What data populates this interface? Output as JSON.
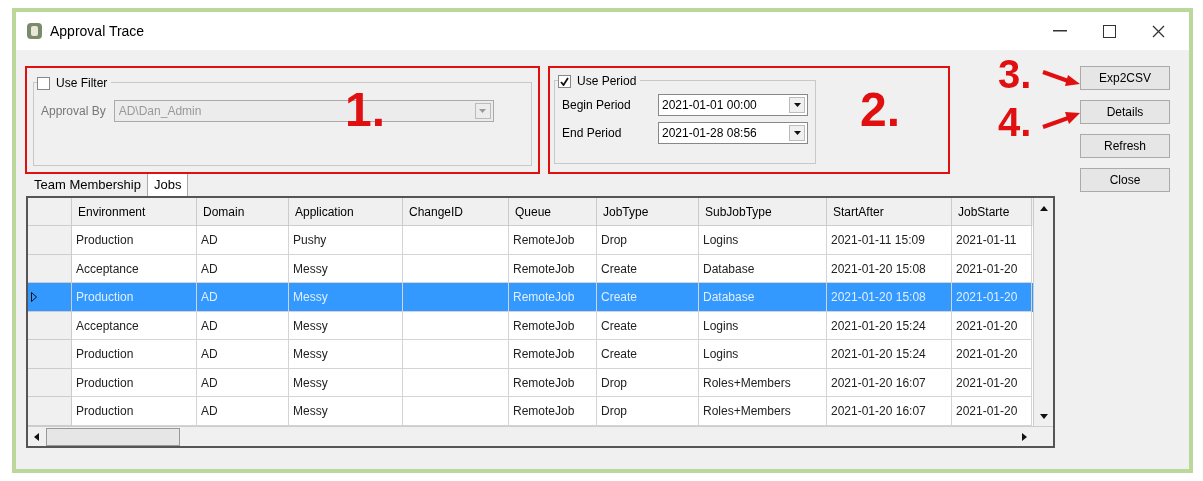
{
  "window": {
    "title": "Approval Trace"
  },
  "filter_group": {
    "label": "Use Filter",
    "checked": false,
    "field_label": "Approval By",
    "value": "AD\\Dan_Admin",
    "disabled": true
  },
  "period_group": {
    "label": "Use Period",
    "checked": true,
    "begin_label": "Begin Period",
    "begin_value": "2021-01-01 00:00",
    "end_label": "End Period",
    "end_value": "2021-01-28 08:56"
  },
  "buttons": [
    "Exp2CSV",
    "Details",
    "Refresh",
    "Close"
  ],
  "annotations": [
    "1.",
    "2.",
    "3.",
    "4."
  ],
  "tabs": [
    {
      "label": "Team Membership",
      "selected": false
    },
    {
      "label": "Jobs",
      "selected": true
    }
  ],
  "table": {
    "columns": [
      "Environment",
      "Domain",
      "Application",
      "ChangeID",
      "Queue",
      "JobType",
      "SubJobType",
      "StartAfter",
      "JobStarte"
    ],
    "rows": [
      {
        "selected": false,
        "cells": [
          "Production",
          "AD",
          "Pushy",
          "",
          "RemoteJob",
          "Drop",
          "Logins",
          "2021-01-11 15:09",
          "2021-01-11"
        ]
      },
      {
        "selected": false,
        "cells": [
          "Acceptance",
          "AD",
          "Messy",
          "",
          "RemoteJob",
          "Create",
          "Database",
          "2021-01-20 15:08",
          "2021-01-20"
        ]
      },
      {
        "selected": true,
        "cells": [
          "Production",
          "AD",
          "Messy",
          "",
          "RemoteJob",
          "Create",
          "Database",
          "2021-01-20 15:08",
          "2021-01-20"
        ]
      },
      {
        "selected": false,
        "cells": [
          "Acceptance",
          "AD",
          "Messy",
          "",
          "RemoteJob",
          "Create",
          "Logins",
          "2021-01-20 15:24",
          "2021-01-20"
        ]
      },
      {
        "selected": false,
        "cells": [
          "Production",
          "AD",
          "Messy",
          "",
          "RemoteJob",
          "Create",
          "Logins",
          "2021-01-20 15:24",
          "2021-01-20"
        ]
      },
      {
        "selected": false,
        "cells": [
          "Production",
          "AD",
          "Messy",
          "",
          "RemoteJob",
          "Drop",
          "Roles+Members",
          "2021-01-20 16:07",
          "2021-01-20"
        ]
      },
      {
        "selected": false,
        "cells": [
          "Production",
          "AD",
          "Messy",
          "",
          "RemoteJob",
          "Drop",
          "Roles+Members",
          "2021-01-20 16:07",
          "2021-01-20"
        ]
      }
    ]
  }
}
